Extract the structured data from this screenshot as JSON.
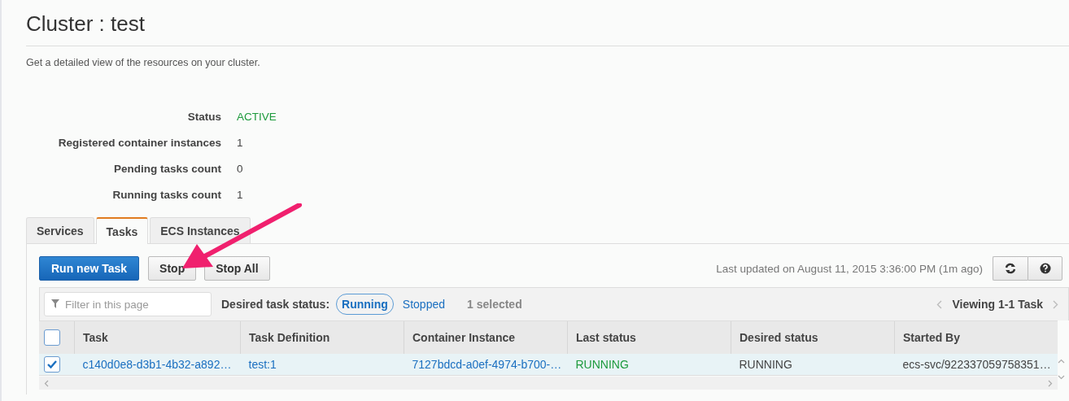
{
  "page": {
    "title": "Cluster : test",
    "subtitle": "Get a detailed view of the resources on your cluster."
  },
  "summary": [
    {
      "label": "Status",
      "value": "ACTIVE",
      "kind": "status"
    },
    {
      "label": "Registered container instances",
      "value": "1",
      "kind": "plain"
    },
    {
      "label": "Pending tasks count",
      "value": "0",
      "kind": "plain"
    },
    {
      "label": "Running tasks count",
      "value": "1",
      "kind": "plain"
    }
  ],
  "tabs": [
    {
      "label": "Services",
      "selected": false
    },
    {
      "label": "Tasks",
      "selected": true
    },
    {
      "label": "ECS Instances",
      "selected": false
    }
  ],
  "toolbar": {
    "buttons": [
      {
        "label": "Run new Task",
        "kind": "primary"
      },
      {
        "label": "Stop",
        "kind": "default"
      },
      {
        "label": "Stop All",
        "kind": "default"
      }
    ],
    "last_updated": "Last updated on August 11, 2015 3:36:00 PM (1m ago)"
  },
  "filter": {
    "placeholder": "Filter in this page",
    "status_label": "Desired task status:",
    "options": [
      {
        "label": "Running",
        "selected": true
      },
      {
        "label": "Stopped",
        "selected": false
      }
    ],
    "selection_count": "1 selected",
    "pagination": "Viewing 1-1 Task"
  },
  "table": {
    "all_checked": false,
    "columns": [
      "Task",
      "Task Definition",
      "Container Instance",
      "Last status",
      "Desired status",
      "Started By"
    ],
    "rows": [
      {
        "selected": true,
        "cells": [
          {
            "text": "c140d0e8-d3b1-4b32-a892…",
            "kind": "link"
          },
          {
            "text": "test:1",
            "kind": "link"
          },
          {
            "text": "7127bdcd-a0ef-4974-b700-…",
            "kind": "link"
          },
          {
            "text": "RUNNING",
            "kind": "status"
          },
          {
            "text": "RUNNING",
            "kind": "plain"
          },
          {
            "text": "ecs-svc/922337059758351…",
            "kind": "plain"
          }
        ]
      }
    ]
  }
}
